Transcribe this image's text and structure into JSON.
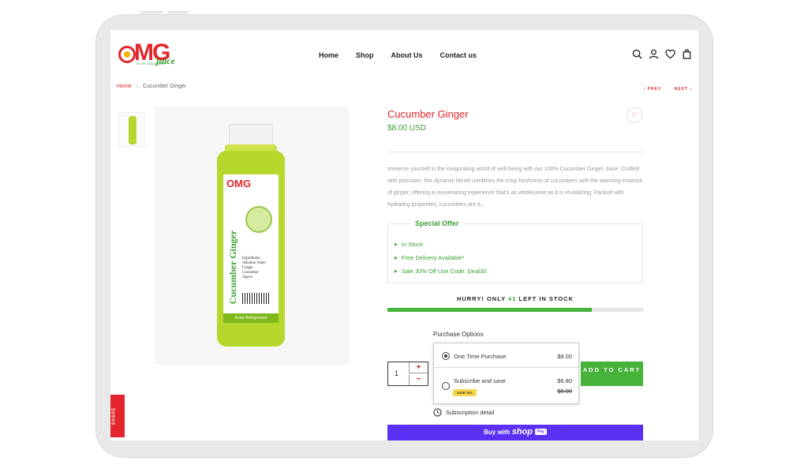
{
  "nav": {
    "items": [
      "Home",
      "Shop",
      "About Us",
      "Contact us"
    ]
  },
  "logo": {
    "text": "OMG",
    "sub": "juice",
    "tagline": "OH MY GOODNESS"
  },
  "breadcrumb": {
    "home": "Home",
    "sep": "›",
    "current": "Cucumber Ginger"
  },
  "pager": {
    "prev": "‹ PREV",
    "next": "NEXT ›"
  },
  "product": {
    "title": "Cucumber Ginger",
    "price": "$8.00 USD",
    "description": "Immerse yourself in the invigorating world of well-being with our 100% Cucumber Ginger Juice. Crafted with precision, this dynamic blend combines the crisp freshness of cucumbers with the warming essence of ginger, offering a rejuvenating experience that's as wholesome as it is revitalizing. Packed with hydrating properties, cucumbers are a..."
  },
  "bottle": {
    "brand": "OMG",
    "name": "Cucumber Ginger",
    "ingredients": [
      "Ingredients:",
      "Alkaline Water",
      "Ginger",
      "Cucumber",
      "Agave"
    ],
    "keep": "Keep Refrigerated"
  },
  "offer": {
    "title": "Special Offer",
    "items": [
      "In Stock",
      "Free Delivery Available*",
      "Sale 30% Off Use Code: Deal30"
    ]
  },
  "stock": {
    "prefix": "HURRY! ONLY",
    "count": "41",
    "suffix": "LEFT IN STOCK",
    "level": 0.8
  },
  "purchase": {
    "label": "Purchase Options",
    "one_time": {
      "label": "One Time Purchase",
      "price": "$8.00"
    },
    "subscribe": {
      "label": "Subscribe and save",
      "price": "$6.80",
      "old_price": "$8.00",
      "badge": "SAVE 15%"
    },
    "detail": "Subscription detail"
  },
  "quantity": {
    "value": "1",
    "plus": "+",
    "minus": "−"
  },
  "cart": {
    "label": "ADD TO CART"
  },
  "shoppay": {
    "prefix": "Buy with",
    "brand": "shop",
    "pay": "Pay"
  },
  "share": {
    "label": "SHARE"
  },
  "colors": {
    "brand_red": "#e2262c",
    "brand_green": "#3aa132",
    "cart_green": "#46b23a",
    "shop_purple": "#5a31f4"
  }
}
